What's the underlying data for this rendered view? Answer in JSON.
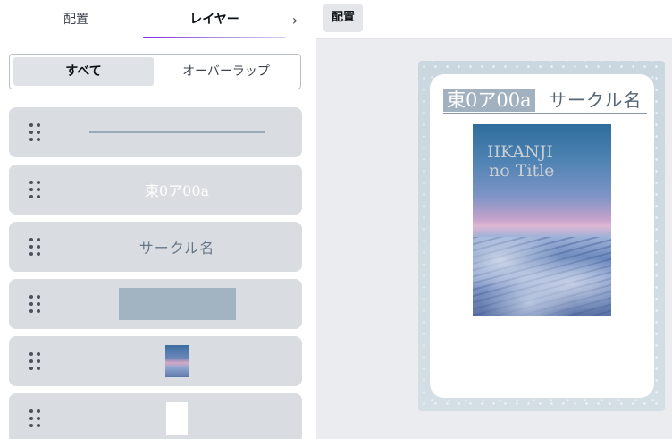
{
  "left_panel": {
    "tabs": [
      {
        "label": "配置"
      },
      {
        "label": "レイヤー"
      }
    ],
    "next_label": "›",
    "filter": {
      "all_label": "すべて",
      "overlap_label": "オーバーラップ"
    },
    "layers": [
      {
        "kind": "line",
        "text": ""
      },
      {
        "kind": "text",
        "text": "東0ア00a"
      },
      {
        "kind": "text",
        "text": "サークル名"
      },
      {
        "kind": "shape",
        "text": ""
      },
      {
        "kind": "image",
        "text": ""
      },
      {
        "kind": "image",
        "text": ""
      }
    ]
  },
  "canvas": {
    "arrange_button": "配置",
    "card": {
      "title_main": "東0ア00a",
      "title_sub": "サークル名",
      "cover_title_line1": "IIKANJI",
      "cover_title_line2": "no Title"
    }
  },
  "colors": {
    "accent": "#7d2ae8",
    "layer_bg": "#d9dce1",
    "title_highlight": "#a1b1bf"
  }
}
